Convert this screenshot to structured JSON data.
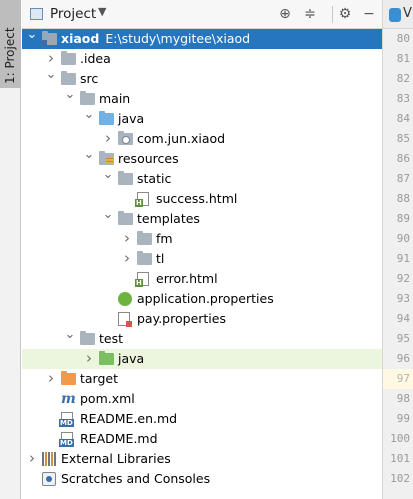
{
  "tool_strip": {
    "tab_label": "1: Project"
  },
  "header": {
    "title": "Project",
    "buttons": [
      "locate-icon",
      "collapse-all-icon",
      "gear-icon",
      "minimize-icon"
    ]
  },
  "tree": [
    {
      "label": "xiaod",
      "sub": "E:\\study\\mygitee\\xiaod",
      "icon": "project-folder-icon",
      "level": 0,
      "expanded": true,
      "selected": true
    },
    {
      "label": ".idea",
      "icon": "folder-icon",
      "level": 1,
      "expanded": false
    },
    {
      "label": "src",
      "icon": "folder-icon",
      "level": 1,
      "expanded": true
    },
    {
      "label": "main",
      "icon": "folder-icon",
      "level": 2,
      "expanded": true
    },
    {
      "label": "java",
      "icon": "source-folder-icon",
      "level": 3,
      "expanded": true
    },
    {
      "label": "com.jun.xiaod",
      "icon": "package-icon",
      "level": 4,
      "expanded": false
    },
    {
      "label": "resources",
      "icon": "resources-folder-icon",
      "level": 3,
      "expanded": true
    },
    {
      "label": "static",
      "icon": "folder-icon",
      "level": 4,
      "expanded": true
    },
    {
      "label": "success.html",
      "icon": "html-file-icon",
      "level": 5
    },
    {
      "label": "templates",
      "icon": "folder-icon",
      "level": 4,
      "expanded": true
    },
    {
      "label": "fm",
      "icon": "folder-icon",
      "level": 5,
      "expanded": false
    },
    {
      "label": "tl",
      "icon": "folder-icon",
      "level": 5,
      "expanded": false
    },
    {
      "label": "error.html",
      "icon": "html-file-icon",
      "level": 5
    },
    {
      "label": "application.properties",
      "icon": "spring-properties-icon",
      "level": 4
    },
    {
      "label": "pay.properties",
      "icon": "properties-file-icon",
      "level": 4
    },
    {
      "label": "test",
      "icon": "folder-icon",
      "level": 2,
      "expanded": true
    },
    {
      "label": "java",
      "icon": "test-folder-icon",
      "level": 3,
      "expanded": false,
      "highlighted": true
    },
    {
      "label": "target",
      "icon": "excluded-folder-icon",
      "level": 1,
      "expanded": false
    },
    {
      "label": "pom.xml",
      "icon": "maven-icon",
      "level": 1
    },
    {
      "label": "README.en.md",
      "icon": "markdown-file-icon",
      "level": 1
    },
    {
      "label": "README.md",
      "icon": "markdown-file-icon",
      "level": 1
    },
    {
      "label": "External Libraries",
      "icon": "libraries-icon",
      "level": 0,
      "expanded": false
    },
    {
      "label": "Scratches and Consoles",
      "icon": "scratches-icon",
      "level": 0
    }
  ],
  "editor": {
    "tab_text": "V",
    "line_numbers": [
      "80",
      "81",
      "82",
      "83",
      "84",
      "85",
      "86",
      "87",
      "88",
      "89",
      "90",
      "91",
      "92",
      "93",
      "94",
      "95",
      "96",
      "97",
      "98",
      "99",
      "100",
      "101",
      "102"
    ],
    "current_line": "97"
  }
}
